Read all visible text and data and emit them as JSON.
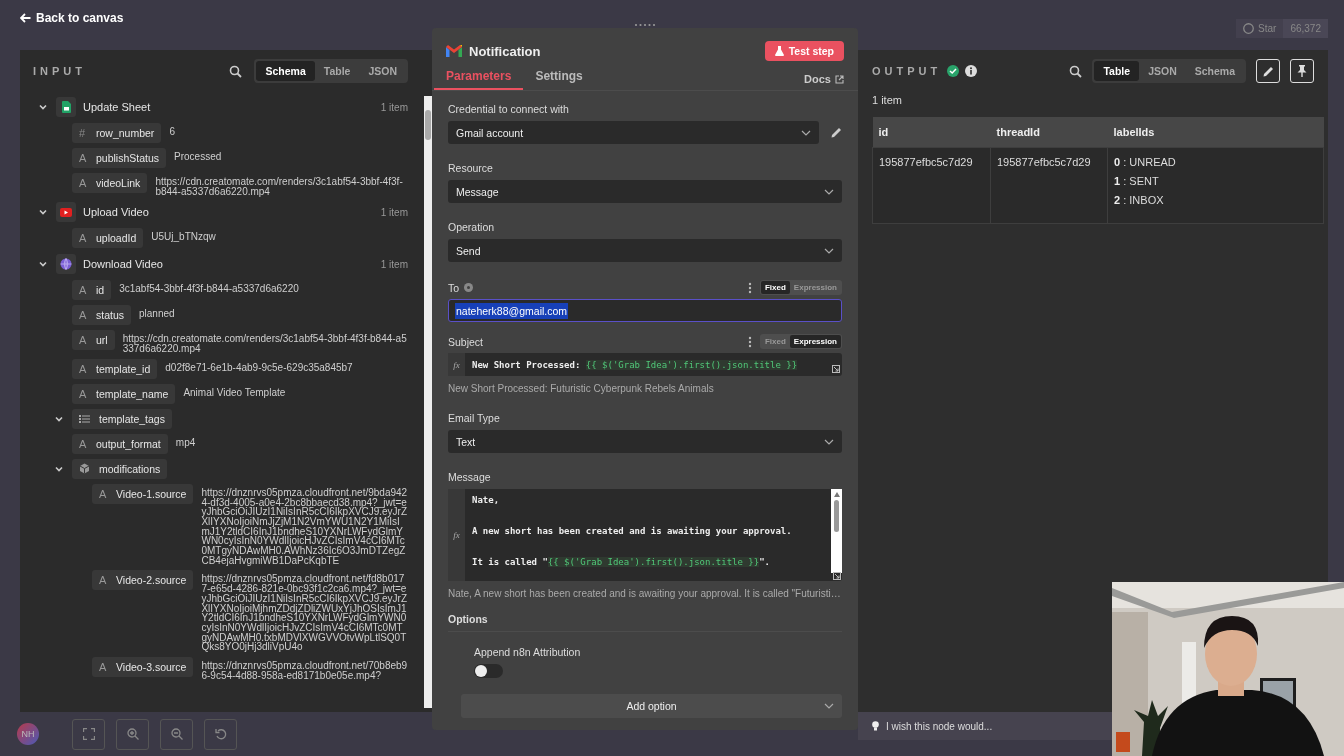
{
  "top_bar": {
    "back_link": "Back to canvas",
    "github_star": {
      "label": "Star",
      "count": "66,372"
    }
  },
  "input": {
    "title": "INPUT",
    "views": [
      {
        "label": "Schema",
        "selected": true
      },
      {
        "label": "Table",
        "selected": false
      },
      {
        "label": "JSON",
        "selected": false
      }
    ],
    "nodes": [
      {
        "kind": "sheet",
        "name": "Update Sheet",
        "count": "1 item",
        "expanded": true,
        "fields": [
          {
            "kind": "number",
            "mark": "#",
            "name": "row_number",
            "value": "6"
          },
          {
            "kind": "string",
            "mark": "A",
            "name": "publishStatus",
            "value": "Processed"
          },
          {
            "kind": "string",
            "mark": "A",
            "name": "videoLink",
            "value": "https://cdn.creatomate.com/renders/3c1abf54-3bbf-4f3f-b844-a5337d6a6220.mp4"
          }
        ]
      },
      {
        "kind": "youtube",
        "name": "Upload Video",
        "count": "1 item",
        "expanded": true,
        "fields": [
          {
            "kind": "string",
            "mark": "A",
            "name": "uploadId",
            "value": "U5Uj_bTNzqw"
          }
        ]
      },
      {
        "kind": "http",
        "name": "Download Video",
        "count": "1 item",
        "expanded": true,
        "fields": [
          {
            "kind": "string",
            "mark": "A",
            "name": "id",
            "value": "3c1abf54-3bbf-4f3f-b844-a5337d6a6220"
          },
          {
            "kind": "string",
            "mark": "A",
            "name": "status",
            "value": "planned"
          },
          {
            "kind": "string",
            "mark": "A",
            "name": "url",
            "value": "https://cdn.creatomate.com/renders/3c1abf54-3bbf-4f3f-b844-a5337d6a6220.mp4"
          },
          {
            "kind": "string",
            "mark": "A",
            "name": "template_id",
            "value": "d02f8e71-6e1b-4ab9-9c5e-629c35a845b7"
          },
          {
            "kind": "string",
            "mark": "A",
            "name": "template_name",
            "value": "Animal Video Template"
          },
          {
            "kind": "array",
            "name": "template_tags",
            "expanded": true
          },
          {
            "kind": "string",
            "mark": "A",
            "name": "output_format",
            "value": "mp4"
          },
          {
            "kind": "object",
            "name": "modifications",
            "expanded": true,
            "children": [
              {
                "kind": "string",
                "mark": "A",
                "name": "Video-1.source",
                "value": "https://dnznrvs05pmza.cloudfront.net/9bda9424-df3d-4005-a0e4-2bc8bbaecd38.mp4?_jwt=eyJhbGciOiJIUzI1NiIsInR5cCI6IkpXVCJ9.eyJrZXlIYXNoIjoiNmJjZjM1N2VmYWU1N2Y1MiIsImJ1Y2tldCI6InJ1bndheS10YXNrLWFydGlmYWN0cyIsInN0YWdlIjoicHJvZCIsImV4cCI6MTc0MTgyNDAwMH0.AWhNz36Ic6O3JmDTZegZCB4ejaHvgmiWB1DaPcKqbTE"
              },
              {
                "kind": "string",
                "mark": "A",
                "name": "Video-2.source",
                "value": "https://dnznrvs05pmza.cloudfront.net/fd8b0177-e65d-4286-821e-0bc93f1c2ca6.mp4?_jwt=eyJhbGciOiJIUzI1NiIsInR5cCI6IkpXVCJ9.eyJrZXlIYXNoIjoiMjhmZDdjZDliZWUxYjJhOSIsImJ1Y2tldCI6InJ1bndheS10YXNrLWFydGlmYWN0cyIsInN0YWdlIjoicHJvZCIsImV4cCI6MTc0MTgyNDAwMH0.txbMDVlXWGVVOtvWpLtlSQ0TQks8YO0jHj3dliVpU4o"
              },
              {
                "kind": "string",
                "mark": "A",
                "name": "Video-3.source",
                "value": "https://dnznrvs05pmza.cloudfront.net/70b8eb96-9c54-4d88-958a-ed8171b0e05e.mp4?"
              }
            ]
          }
        ]
      }
    ]
  },
  "node": {
    "title": "Notification",
    "test_button": "Test step",
    "tabs": [
      {
        "label": "Parameters",
        "selected": true
      },
      {
        "label": "Settings",
        "selected": false
      }
    ],
    "docs_link": "Docs",
    "credential": {
      "label": "Credential to connect with",
      "value": "Gmail account"
    },
    "resource": {
      "label": "Resource",
      "value": "Message"
    },
    "operation": {
      "label": "Operation",
      "value": "Send"
    },
    "to": {
      "label": "To",
      "value": "nateherk88@gmail.com",
      "modes": [
        {
          "label": "Fixed",
          "selected": true
        },
        {
          "label": "Expression",
          "selected": false
        }
      ]
    },
    "subject": {
      "label": "Subject",
      "fx": "fx",
      "text": "New Short Processed: ",
      "expression": "{{ $('Grab Idea').first().json.title }}",
      "preview": "New Short Processed: Futuristic Cyberpunk Rebels Animals",
      "modes": [
        {
          "label": "Fixed",
          "selected": false
        },
        {
          "label": "Expression",
          "selected": true
        }
      ]
    },
    "email_type": {
      "label": "Email Type",
      "value": "Text"
    },
    "message": {
      "label": "Message",
      "fx": "fx",
      "lines": [
        {
          "text": "Nate,"
        },
        {
          "text": "A new short has been created and is awaiting your approval."
        },
        {
          "text": "It is called \"",
          "expression": "{{ $('Grab Idea').first().json.title }}",
          "suffix": "\"."
        }
      ],
      "preview": "Nate, A new short has been created and is awaiting your approval. It is called \"Futuristi…"
    },
    "options": {
      "label": "Options",
      "toggle": {
        "label": "Append n8n Attribution",
        "on": false
      },
      "add_button": "Add option"
    }
  },
  "output": {
    "title": "OUTPUT",
    "views": [
      {
        "label": "Table",
        "selected": true
      },
      {
        "label": "JSON",
        "selected": false
      },
      {
        "label": "Schema",
        "selected": false
      }
    ],
    "count": "1 item",
    "columns": [
      "id",
      "threadId",
      "labelIds"
    ],
    "rows": [
      {
        "id": "195877efbc5c7d29",
        "threadId": "195877efbc5c7d29",
        "labelIds": [
          "**0** : UNREAD",
          "**1** : SENT",
          "**2** : INBOX"
        ]
      }
    ],
    "feedback": "I wish this node would..."
  },
  "canvas": {
    "avatar": "NH"
  }
}
